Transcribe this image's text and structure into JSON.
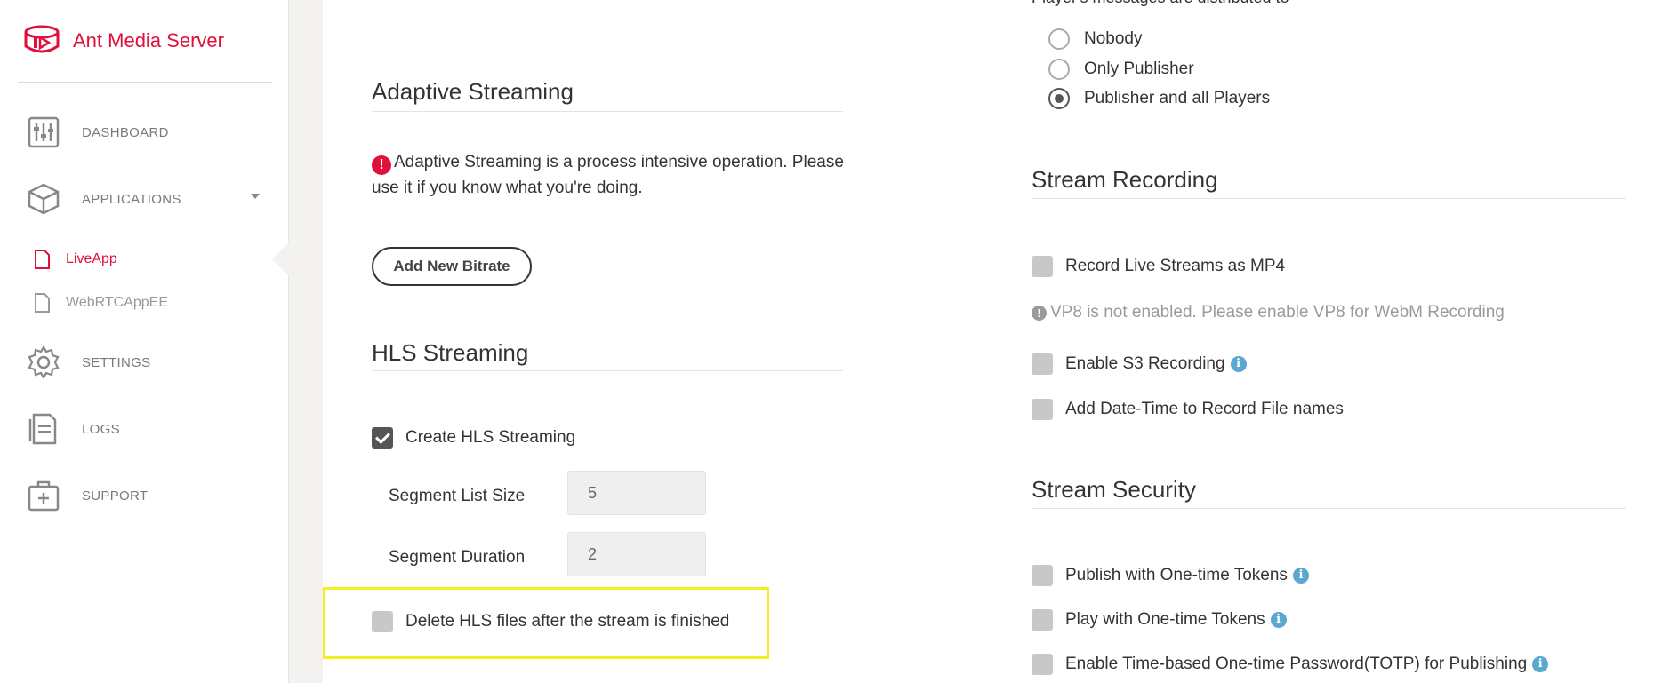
{
  "brand": {
    "name": "Ant Media Server",
    "accent": "#e0103c"
  },
  "nav": {
    "dashboard": "DASHBOARD",
    "applications": "APPLICATIONS",
    "apps": [
      "LiveApp",
      "WebRTCAppEE"
    ],
    "settings": "SETTINGS",
    "logs": "LOGS",
    "support": "SUPPORT"
  },
  "adaptive": {
    "title": "Adaptive Streaming",
    "warning": "Adaptive Streaming is a process intensive operation. Please use it if you know what you're doing.",
    "add_button": "Add New Bitrate"
  },
  "hls": {
    "title": "HLS Streaming",
    "create_label": "Create HLS Streaming",
    "create_checked": true,
    "segment_list_label": "Segment List Size",
    "segment_list_value": "5",
    "segment_duration_label": "Segment Duration",
    "segment_duration_value": "2",
    "delete_label": "Delete HLS files after the stream is finished",
    "delete_checked": false
  },
  "players": {
    "heading": "Player's messages are distributed to",
    "options": [
      "Nobody",
      "Only Publisher",
      "Publisher and all Players"
    ],
    "selected": "Publisher and all Players"
  },
  "recording": {
    "title": "Stream Recording",
    "mp4_label": "Record Live Streams as MP4",
    "vp8_note": "VP8 is not enabled. Please enable VP8 for WebM Recording",
    "s3_label": "Enable S3 Recording",
    "datetime_label": "Add Date-Time to Record File names"
  },
  "security": {
    "title": "Stream Security",
    "publish_token_label": "Publish with One-time Tokens",
    "play_token_label": "Play with One-time Tokens",
    "totp_label": "Enable Time-based One-time Password(TOTP) for Publishing"
  }
}
